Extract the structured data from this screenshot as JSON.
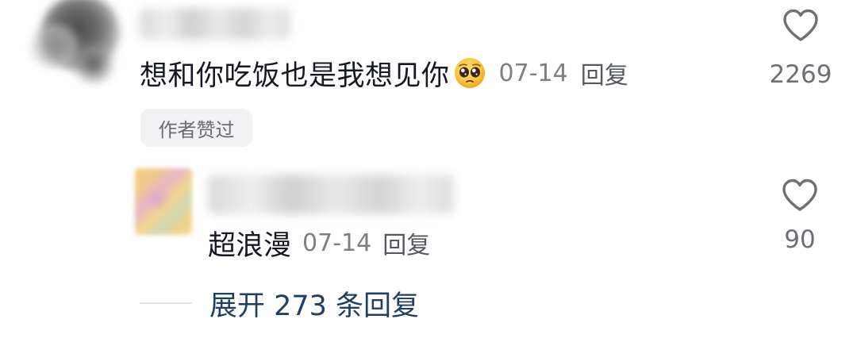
{
  "comment": {
    "text": "想和你吃饭也是我想见你",
    "emoji": "pleading-face",
    "date": "07-14",
    "reply_label": "回复",
    "author_badge": "作者赞过",
    "like_count": "2269"
  },
  "reply": {
    "text": "超浪漫",
    "date": "07-14",
    "reply_label": "回复",
    "like_count": "90"
  },
  "expand": {
    "label": "展开 273 条回复"
  },
  "colors": {
    "text": "#161823",
    "meta": "#7d7f85",
    "expand": "#1f3f66",
    "badge_bg": "#f2f2f4"
  },
  "icons": {
    "like": "heart-outline-icon"
  }
}
